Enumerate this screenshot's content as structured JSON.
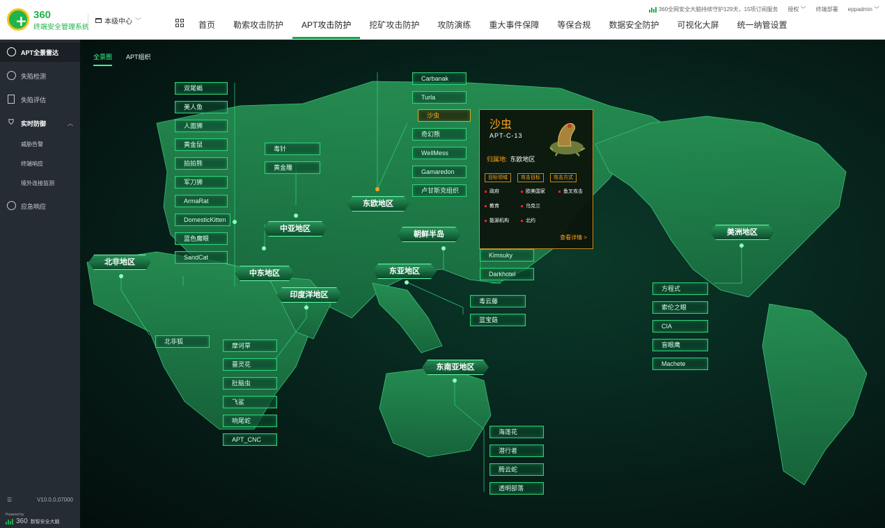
{
  "header": {
    "logo_360": "360",
    "logo_sub": "终端安全管理系统",
    "center": "本级中心",
    "nav": [
      "首页",
      "勒索攻击防护",
      "APT攻击防护",
      "挖矿攻击防护",
      "攻防演练",
      "重大事件保障",
      "等保合规",
      "数据安全防护",
      "可视化大屏",
      "统一纳管设置"
    ],
    "active_nav": "APT攻击防护",
    "status": "360全网安全大脑持续守护129天，15项订阅服务",
    "license": "授权",
    "deploy": "终端部署",
    "user": "eppadmin"
  },
  "sidebar": {
    "items": [
      "APT全景雷达",
      "失陷检测",
      "失陷评估",
      "实时防御",
      "应急响应"
    ],
    "sub": [
      "威胁告警",
      "终端响应",
      "境外连接监测"
    ],
    "version": "V10.0.0.07000",
    "powered": "Powered by",
    "powered_brand": "360",
    "powered_suffix": "数智安全大脑"
  },
  "main": {
    "tabs": [
      "全景图",
      "APT组织"
    ],
    "regions": {
      "north_africa": "北非地区",
      "central_asia": "中亚地区",
      "middle_east": "中东地区",
      "indian_ocean": "印度洋地区",
      "east_europe": "东欧地区",
      "korea": "朝鲜半岛",
      "east_asia": "东亚地区",
      "southeast_asia": "东南亚地区",
      "americas": "美洲地区"
    },
    "groups": {
      "west": [
        "双尾蝎",
        "美人鱼",
        "人面狮",
        "黄金鼠",
        "拍拍熊",
        "军刀狮",
        "ArmaRat",
        "DomesticKitten",
        "蓝色魔眼",
        "SandCat"
      ],
      "central": [
        "毒针",
        "黄金雕"
      ],
      "north_africa": [
        "北非狐"
      ],
      "indian": [
        "摩诃草",
        "蔓灵花",
        "肚脑虫",
        "飞鲨",
        "响尾蛇",
        "APT_CNC"
      ],
      "east_europe": [
        "Carbanak",
        "Turla",
        "沙虫",
        "奇幻熊",
        "WellMess",
        "Gamaredon",
        "卢甘斯克组织"
      ],
      "korea": [
        "Kimsuky",
        "Darkhotel"
      ],
      "east_asia": [
        "毒云藤",
        "蓝宝菇"
      ],
      "southeast_asia": [
        "海莲花",
        "潜行者",
        "腾云蛇",
        "透明部落"
      ],
      "americas": [
        "方程式",
        "索伦之眼",
        "CIA",
        "盲眼鹰",
        "Machete"
      ]
    },
    "popup": {
      "name": "沙虫",
      "code": "APT-C-13",
      "origin_label": "归属地:",
      "origin": "东欧地区",
      "tabs": [
        "目标领域",
        "攻击目标",
        "攻击方式"
      ],
      "fields": [
        "政府",
        "教育",
        "能源机构"
      ],
      "targets": [
        "欧美国家",
        "乌克兰",
        "北约"
      ],
      "methods": [
        "鱼叉攻击"
      ],
      "more": "查看详情 >"
    }
  },
  "colors": {
    "accent": "#3cff8e",
    "popup": "#ffa41b",
    "brand": "#20b54a"
  }
}
